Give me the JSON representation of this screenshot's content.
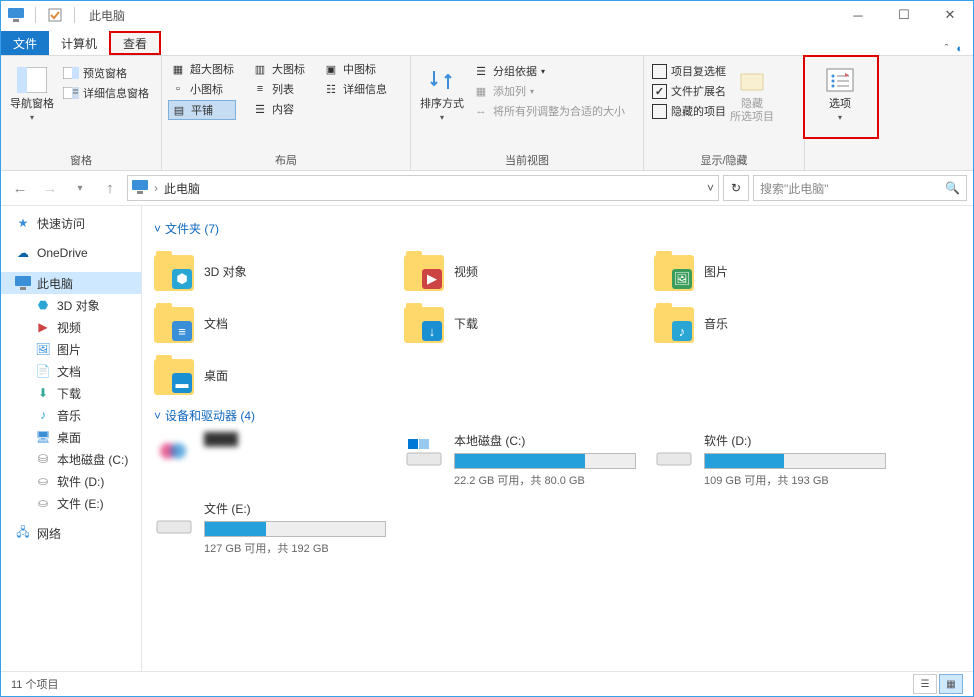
{
  "window_title": "此电脑",
  "tabs": {
    "file": "文件",
    "computer": "计算机",
    "view": "查看"
  },
  "ribbon": {
    "panes": {
      "label": "窗格",
      "nav_pane": "导航窗格",
      "preview_pane": "预览窗格",
      "details_pane": "详细信息窗格"
    },
    "layout": {
      "label": "布局",
      "xl_icons": "超大图标",
      "l_icons": "大图标",
      "m_icons": "中图标",
      "s_icons": "小图标",
      "list": "列表",
      "details": "详细信息",
      "tiles": "平铺",
      "content": "内容"
    },
    "current_view": {
      "label": "当前视图",
      "sort_by": "排序方式",
      "group_by": "分组依据",
      "add_columns": "添加列",
      "size_all": "将所有列调整为合适的大小"
    },
    "show_hide": {
      "label": "显示/隐藏",
      "checkboxes": "项目复选框",
      "extensions": "文件扩展名",
      "hidden_items": "隐藏的项目",
      "hide_selected": "隐藏\n所选项目"
    },
    "options": "选项"
  },
  "address": {
    "location": "此电脑"
  },
  "search": {
    "placeholder": "搜索\"此电脑\""
  },
  "sidebar": {
    "quick_access": "快速访问",
    "onedrive": "OneDrive",
    "this_pc": "此电脑",
    "objects3d": "3D 对象",
    "videos": "视频",
    "pictures": "图片",
    "documents": "文档",
    "downloads": "下载",
    "music": "音乐",
    "desktop": "桌面",
    "drive_c": "本地磁盘 (C:)",
    "drive_d": "软件 (D:)",
    "drive_e": "文件 (E:)",
    "network": "网络"
  },
  "sections": {
    "folders_header": "文件夹 (7)",
    "devices_header": "设备和驱动器 (4)"
  },
  "folders": {
    "objects3d": "3D 对象",
    "videos": "视频",
    "pictures": "图片",
    "documents": "文档",
    "downloads": "下载",
    "music": "音乐",
    "desktop": "桌面"
  },
  "drives": {
    "c": {
      "name": "本地磁盘 (C:)",
      "sub": "22.2 GB 可用，共 80.0 GB",
      "fill": 72
    },
    "d": {
      "name": "软件 (D:)",
      "sub": "109 GB 可用，共 193 GB",
      "fill": 44
    },
    "e": {
      "name": "文件 (E:)",
      "sub": "127 GB 可用，共 192 GB",
      "fill": 34
    }
  },
  "status": {
    "count": "11 个项目"
  }
}
